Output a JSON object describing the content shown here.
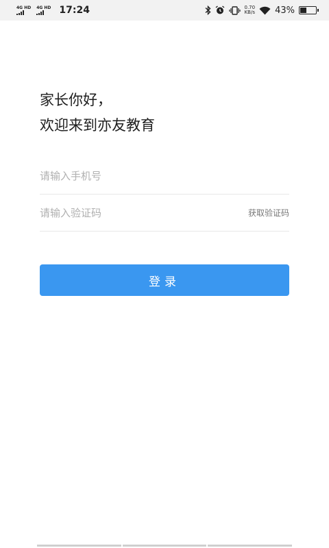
{
  "status_bar": {
    "signal1": "4G HD",
    "signal2": "4G HD",
    "time": "17:24",
    "speed_value": "0.70",
    "speed_unit": "KB/s",
    "battery_percent": "43%",
    "battery_level": 0.43,
    "icons": [
      "bluetooth-icon",
      "alarm-icon",
      "vibrate-icon",
      "wifi-icon",
      "battery-icon"
    ]
  },
  "greeting": {
    "line1": "家长你好，",
    "line2": "欢迎来到亦友教育"
  },
  "form": {
    "phone_placeholder": "请输入手机号",
    "phone_value": "",
    "code_placeholder": "请输入验证码",
    "code_value": "",
    "get_code_label": "获取验证码"
  },
  "login_button": {
    "label": "登录"
  },
  "colors": {
    "accent": "#3a97f0",
    "status_bar_bg": "#f2f2f2"
  }
}
